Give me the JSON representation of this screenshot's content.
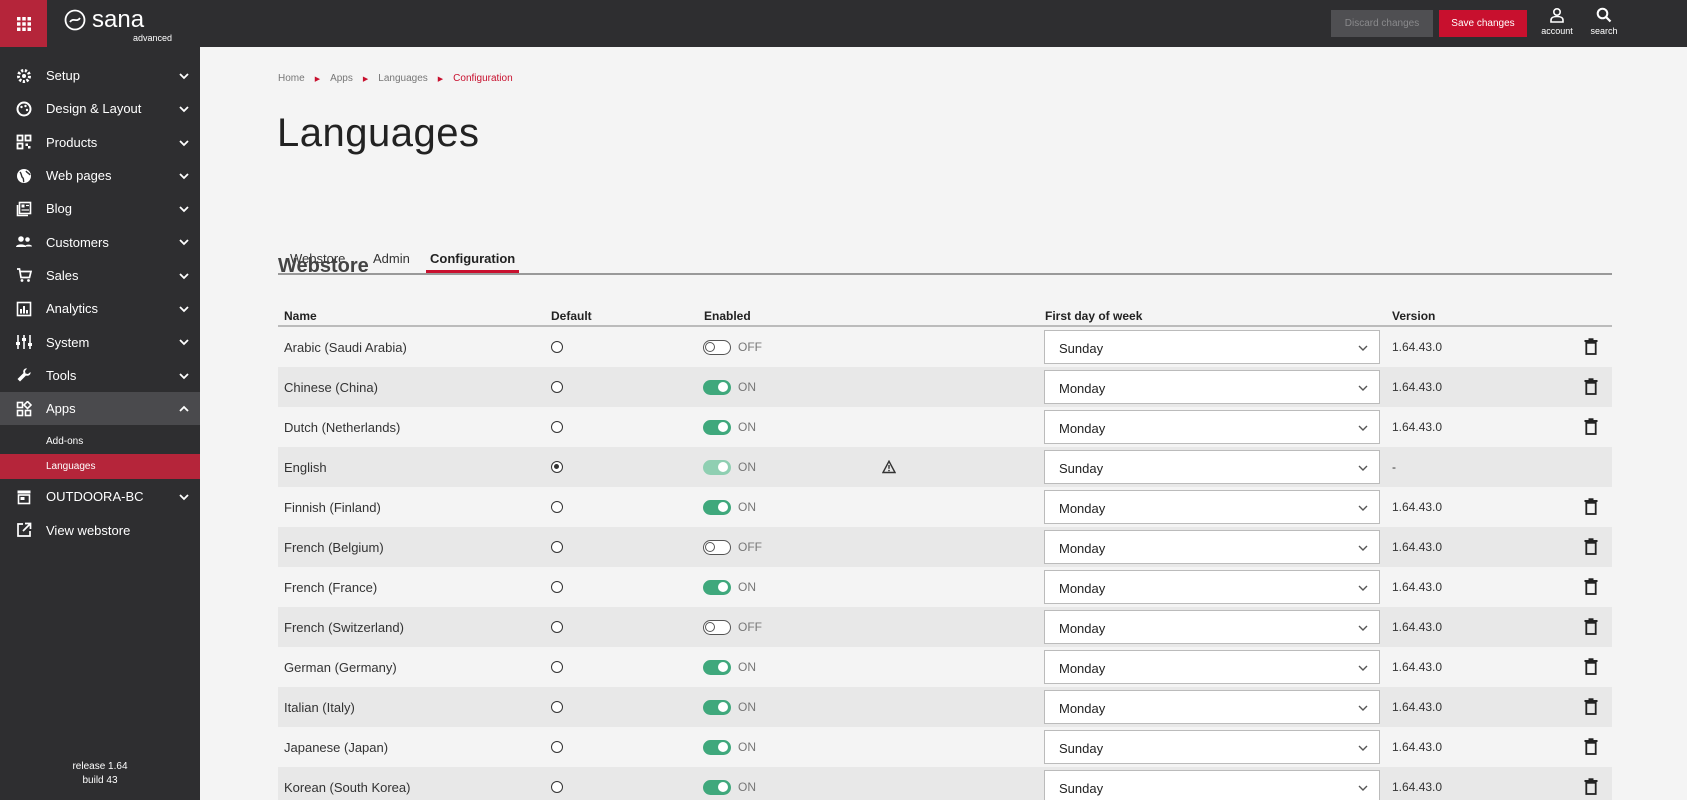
{
  "colors": {
    "accent": "#c8102e",
    "sidebar_bg": "#2e2e30",
    "toggle_on": "#3fa87c"
  },
  "header": {
    "logo_text": "sana",
    "logo_sub": "advanced",
    "discard_label": "Discard changes",
    "save_label": "Save changes",
    "account_label": "account",
    "search_label": "search"
  },
  "sidebar": {
    "items": [
      {
        "label": "Setup",
        "icon": "gear-icon"
      },
      {
        "label": "Design & Layout",
        "icon": "palette-icon"
      },
      {
        "label": "Products",
        "icon": "qr-icon"
      },
      {
        "label": "Web pages",
        "icon": "globe-icon"
      },
      {
        "label": "Blog",
        "icon": "news-icon"
      },
      {
        "label": "Customers",
        "icon": "people-icon"
      },
      {
        "label": "Sales",
        "icon": "cart-icon"
      },
      {
        "label": "Analytics",
        "icon": "chart-icon"
      },
      {
        "label": "System",
        "icon": "sliders-icon"
      },
      {
        "label": "Tools",
        "icon": "wrench-icon"
      },
      {
        "label": "Apps",
        "icon": "apps-icon"
      }
    ],
    "sub_items": [
      {
        "label": "Add-ons"
      },
      {
        "label": "Languages"
      }
    ],
    "extra_items": [
      {
        "label": "OUTDOORA-BC",
        "icon": "store-icon"
      },
      {
        "label": "View webstore",
        "icon": "external-link-icon"
      }
    ],
    "release": "release 1.64",
    "build": "build 43"
  },
  "breadcrumb": [
    "Home",
    "Apps",
    "Languages",
    "Configuration"
  ],
  "page_title": "Languages",
  "tabs": [
    "Webstore",
    "Admin",
    "Configuration"
  ],
  "section_title": "Webstore",
  "table": {
    "headers": [
      "Name",
      "Default",
      "Enabled",
      "First day of week",
      "Version"
    ],
    "rows": [
      {
        "name": "Arabic (Saudi Arabia)",
        "default": false,
        "enabled": false,
        "enabled_label": "OFF",
        "first_day": "Sunday",
        "version": "1.64.43.0"
      },
      {
        "name": "Chinese (China)",
        "default": false,
        "enabled": true,
        "enabled_label": "ON",
        "first_day": "Monday",
        "version": "1.64.43.0"
      },
      {
        "name": "Dutch (Netherlands)",
        "default": false,
        "enabled": true,
        "enabled_label": "ON",
        "first_day": "Monday",
        "version": "1.64.43.0"
      },
      {
        "name": "English",
        "default": true,
        "enabled": true,
        "enabled_label": "ON",
        "first_day": "Sunday",
        "version": "-"
      },
      {
        "name": "Finnish (Finland)",
        "default": false,
        "enabled": true,
        "enabled_label": "ON",
        "first_day": "Monday",
        "version": "1.64.43.0"
      },
      {
        "name": "French (Belgium)",
        "default": false,
        "enabled": false,
        "enabled_label": "OFF",
        "first_day": "Monday",
        "version": "1.64.43.0"
      },
      {
        "name": "French (France)",
        "default": false,
        "enabled": true,
        "enabled_label": "ON",
        "first_day": "Monday",
        "version": "1.64.43.0"
      },
      {
        "name": "French (Switzerland)",
        "default": false,
        "enabled": false,
        "enabled_label": "OFF",
        "first_day": "Monday",
        "version": "1.64.43.0"
      },
      {
        "name": "German (Germany)",
        "default": false,
        "enabled": true,
        "enabled_label": "ON",
        "first_day": "Monday",
        "version": "1.64.43.0"
      },
      {
        "name": "Italian (Italy)",
        "default": false,
        "enabled": true,
        "enabled_label": "ON",
        "first_day": "Monday",
        "version": "1.64.43.0"
      },
      {
        "name": "Japanese (Japan)",
        "default": false,
        "enabled": true,
        "enabled_label": "ON",
        "first_day": "Sunday",
        "version": "1.64.43.0"
      },
      {
        "name": "Korean (South Korea)",
        "default": false,
        "enabled": true,
        "enabled_label": "ON",
        "first_day": "Sunday",
        "version": "1.64.43.0"
      }
    ]
  }
}
